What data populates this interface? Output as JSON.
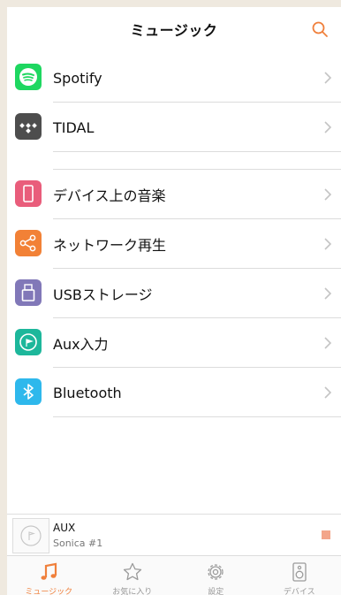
{
  "header": {
    "title": "ミュージック",
    "search_icon": "search-icon"
  },
  "sources": [
    {
      "label": "Spotify",
      "icon": "spotify-icon",
      "color": "#1ed760"
    },
    {
      "label": "TIDAL",
      "icon": "tidal-icon",
      "color": "#4d4d4d"
    }
  ],
  "local": [
    {
      "label": "デバイス上の音楽",
      "icon": "phone-icon",
      "color": "#e95d7b"
    },
    {
      "label": "ネットワーク再生",
      "icon": "share-icon",
      "color": "#f28136"
    },
    {
      "label": "USBストレージ",
      "icon": "usb-icon",
      "color": "#8178b8"
    },
    {
      "label": "Aux入力",
      "icon": "aux-icon",
      "color": "#1db79b"
    },
    {
      "label": "Bluetooth",
      "icon": "bluetooth-icon",
      "color": "#2eb8ec"
    }
  ],
  "now_playing": {
    "title": "AUX",
    "device": "Sonica #1"
  },
  "tabs": [
    {
      "label": "ミュージック",
      "icon": "music-note-icon",
      "active": true
    },
    {
      "label": "お気に入り",
      "icon": "star-icon",
      "active": false
    },
    {
      "label": "設定",
      "icon": "gear-icon",
      "active": false
    },
    {
      "label": "デバイス",
      "icon": "speaker-icon",
      "active": false
    }
  ],
  "colors": {
    "accent": "#f0803c",
    "separator": "#dcdcdc"
  }
}
